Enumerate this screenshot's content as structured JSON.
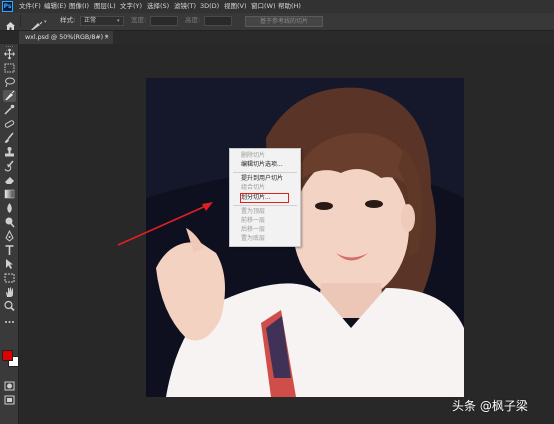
{
  "menubar": {
    "logo": "Ps",
    "items": [
      "文件(F)",
      "编辑(E)",
      "图像(I)",
      "图层(L)",
      "文字(Y)",
      "选择(S)",
      "滤镜(T)",
      "3D(D)",
      "视图(V)",
      "窗口(W)",
      "帮助(H)"
    ]
  },
  "options": {
    "style_label": "样式:",
    "style_value": "正常",
    "width_label": "宽度:",
    "height_label": "高度:",
    "slices_from_guides": "基于参考线的切片"
  },
  "document": {
    "tab_title": "wxl.psd @ 50%(RGB/8#) *",
    "close_glyph": "×"
  },
  "context_menu": {
    "items": [
      {
        "label": "删除切片",
        "enabled": false
      },
      {
        "label": "编辑切片选项...",
        "enabled": true
      },
      {
        "label": "提升到用户切片",
        "enabled": true
      },
      {
        "label": "组合切片",
        "enabled": false
      },
      {
        "label": "划分切片...",
        "enabled": true,
        "highlighted": true
      },
      {
        "label": "置为顶层",
        "enabled": false
      },
      {
        "label": "前移一层",
        "enabled": false
      },
      {
        "label": "后移一层",
        "enabled": false
      },
      {
        "label": "置为底层",
        "enabled": false
      }
    ]
  },
  "colors": {
    "foreground": "#e00000",
    "background": "#ffffff",
    "annotation": "#e02020"
  },
  "tools": [
    "move-icon",
    "marquee-icon",
    "lasso-icon",
    "slice-icon",
    "eyedropper-icon",
    "healing-icon",
    "brush-icon",
    "stamp-icon",
    "history-brush-icon",
    "eraser-icon",
    "gradient-icon",
    "blur-icon",
    "dodge-icon",
    "pen-icon",
    "type-icon",
    "path-select-icon",
    "shape-icon",
    "hand-icon",
    "zoom-icon",
    "more-icon"
  ],
  "watermark": "头条 @枫子梁"
}
